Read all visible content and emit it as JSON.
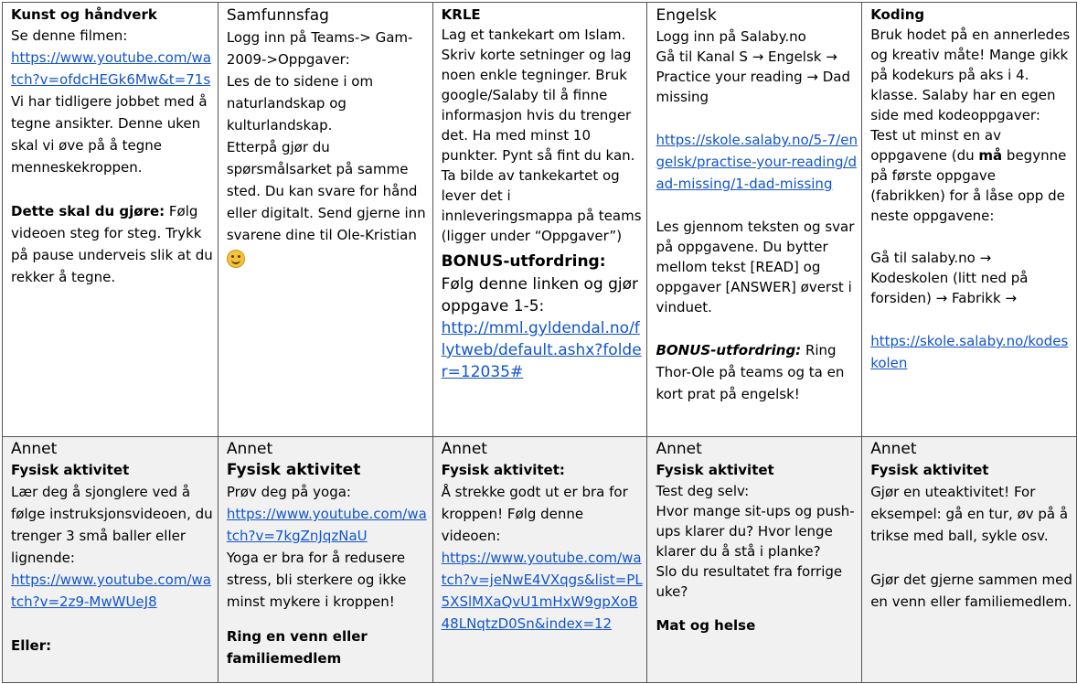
{
  "row1": {
    "kunst": {
      "heading": "Kunst og håndverk",
      "intro": "Se denne filmen:",
      "link": "https://www.youtube.com/watch?v=ofdcHEGk6Mw&t=71s",
      "text1": "Vi har tidligere jobbet med å tegne ansikter. Denne uken skal vi øve på å tegne menneskekroppen.",
      "task_label": "Dette skal du gjøre:",
      "task_text": " Følg videoen steg for steg. Trykk på pause underveis slik at du rekker å tegne."
    },
    "samfunnsfag": {
      "heading": "Samfunnsfag",
      "text1": "Logg inn på Teams-> Gam-2009->Oppgaver:",
      "text2": "Les de to sidene i om naturlandskap og kulturlandskap.",
      "text3": "Etterpå gjør du spørsmålsarket på samme sted. Du kan svare for hånd eller digitalt. Send gjerne inn svarene dine til Ole-Kristian",
      "emoji": "smiley-face-icon"
    },
    "krle": {
      "heading": "KRLE",
      "text1": "Lag et tankekart om Islam. Skriv korte setninger og lag noen enkle tegninger. Bruk google/Salaby til å finne informasjon hvis du trenger det. Ha med minst 10 punkter. Pynt så fint du kan. Ta bilde av tankekartet og lever det i innleveringsmappa på teams (ligger under “Oppgaver”)",
      "bonus_label": "BONUS-utfordring:",
      "bonus_text": "Følg denne linken og gjør oppgave 1-5:",
      "bonus_link": "http://mml.gyldendal.no/flytweb/default.ashx?folder=12035#"
    },
    "engelsk": {
      "heading": "Engelsk",
      "text1": "Logg inn på Salaby.no",
      "text2": "Gå til Kanal S → Engelsk → Practice your reading → Dad missing",
      "link": "https://skole.salaby.no/5-7/engelsk/practise-your-reading/dad-missing/1-dad-missing",
      "text3": "Les gjennom teksten og svar på oppgavene. Du bytter mellom tekst [READ] og oppgaver [ANSWER] øverst i vinduet.",
      "bonus_label": "BONUS-utfordring:",
      "bonus_text": " Ring Thor-Ole på teams og ta en kort prat på engelsk!"
    },
    "koding": {
      "heading": "Koding",
      "text1": "Bruk hodet på en annerledes og kreativ måte! Mange gikk på kodekurs på aks i 4. klasse. Salaby har en egen side med kodeoppgaver:",
      "text2_a": "Test ut minst en av oppgavene (du ",
      "text2_bold": "må",
      "text2_b": " begynne på første oppgave (fabrikken) for å låse opp de neste oppgavene:",
      "text3": "Gå til salaby.no → Kodeskolen (litt ned på forsiden) → Fabrikk →",
      "link": "https://skole.salaby.no/kodeskolen"
    }
  },
  "row2": {
    "c1": {
      "heading": "Annet",
      "sub": "Fysisk aktivitet",
      "text1": "Lær deg å sjonglere ved å følge instruksjonsvideoen, du trenger 3 små baller eller lignende:",
      "link": "https://www.youtube.com/watch?v=2z9-MwWUeJ8",
      "text2": "Eller:"
    },
    "c2": {
      "heading": "Annet",
      "sub": "Fysisk aktivitet",
      "text1": "Prøv deg på yoga:",
      "link": "https://www.youtube.com/watch?v=7kgZnJqzNaU",
      "text2": "Yoga er bra for å redusere stress, bli sterkere og ikke minst mykere i kroppen!",
      "text3": "Ring en venn eller familiemedlem"
    },
    "c3": {
      "heading": "Annet",
      "sub": "Fysisk aktivitet:",
      "text1": "Å strekke godt ut er bra for kroppen!  Følg denne videoen:",
      "link": "https://www.youtube.com/watch?v=jeNwE4VXqgs&list=PL5XSlMXaQvU1mHxW9gpXoB48LNqtzD0Sn&index=12"
    },
    "c4": {
      "heading": "Annet",
      "sub": "Fysisk aktivitet",
      "text1": "Test deg selv:",
      "text2": "Hvor mange sit-ups og push-ups klarer du? Hvor lenge klarer du å stå i planke?",
      "text3": "Slo du resultatet fra forrige uke?",
      "text4": "Mat og helse"
    },
    "c5": {
      "heading": "Annet",
      "sub": "Fysisk aktivitet",
      "text1": "Gjør en uteaktivitet! For eksempel: gå en tur, øv på å trikse med ball, sykle osv.",
      "text2": "Gjør det gjerne sammen med en venn eller familiemedlem."
    }
  }
}
